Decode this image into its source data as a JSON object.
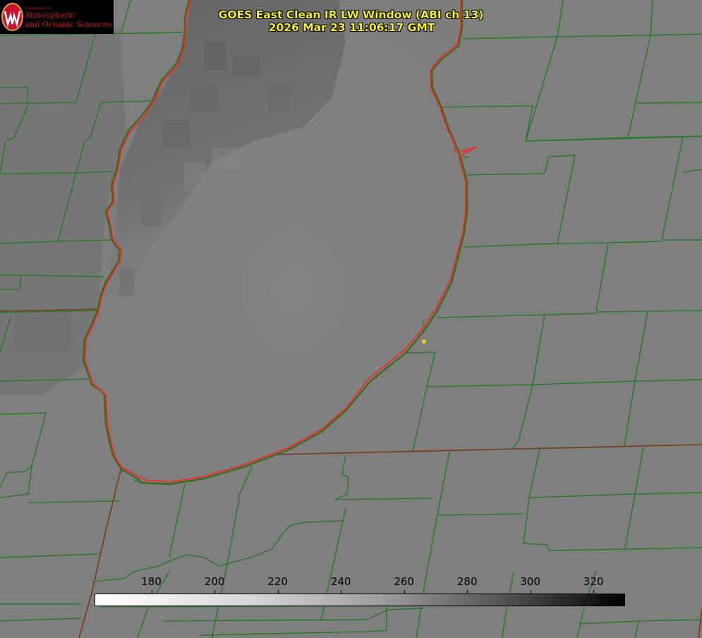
{
  "header": {
    "title_line1": "GOES East Clean IR LW Window (ABI ch 13)",
    "title_line2": "2026 Mar 23 11:06:17 GMT"
  },
  "logo": {
    "department": "Department of",
    "line1": "Atmospheric",
    "line2": "and Oceanic Sciences",
    "crest_letter": "W"
  },
  "colorbar": {
    "unit_values": [
      180,
      200,
      220,
      240,
      260,
      280,
      300,
      320
    ],
    "labels": [
      "180",
      "200",
      "220",
      "240",
      "260",
      "280",
      "300",
      "320"
    ],
    "min": 162,
    "max": 330
  },
  "colors": {
    "county_lines": "#1f7a1f",
    "lake_shore": "#ff2020",
    "title_text": "#f4f02a",
    "logo_red": "#c8102e",
    "marker": "#e6d020"
  }
}
